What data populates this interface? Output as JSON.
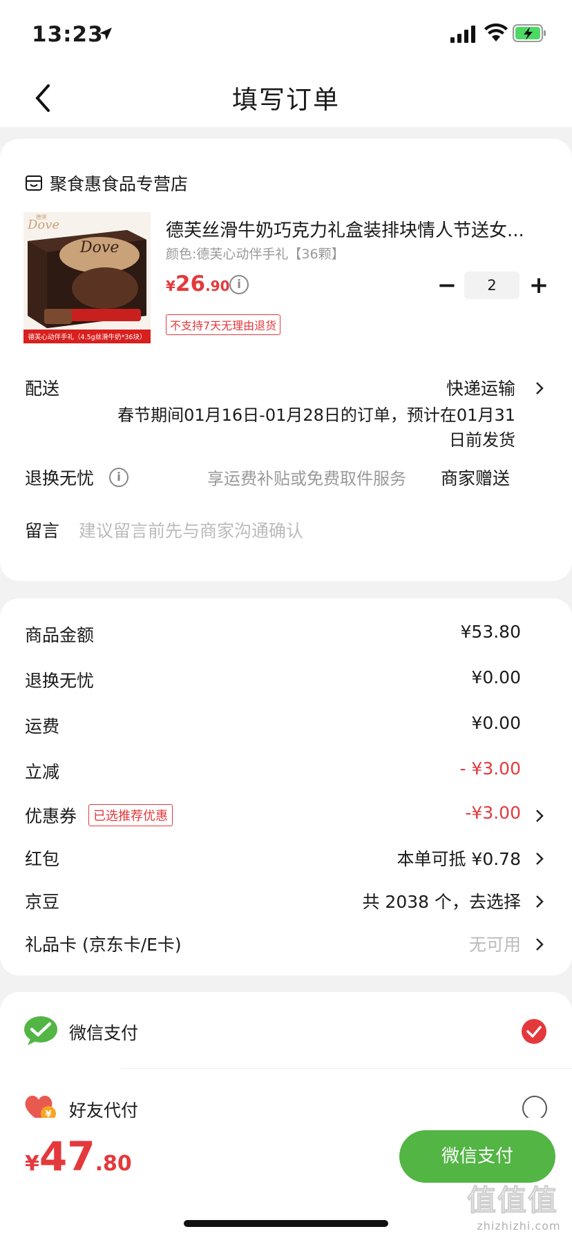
{
  "status_bar": {
    "time": "13:23"
  },
  "nav": {
    "title": "填写订单"
  },
  "store": {
    "name": "聚食惠食品专营店"
  },
  "product": {
    "title": "德芙丝滑牛奶巧克力礼盒装排块情人节送女...",
    "spec": "颜色:德芙心动伴手礼【36颗】",
    "price_currency": "¥",
    "price_int": "26",
    "price_dec": ".90",
    "quantity": "2",
    "badge": "不支持7天无理由退货",
    "image_brand": "Dove",
    "image_brand2": "Dove",
    "image_brand_small": "德芙",
    "image_caption": "德芙心动伴手礼（4.5g丝滑牛奶*36块）"
  },
  "delivery": {
    "label": "配送",
    "method": "快递运输",
    "note_line1": "春节期间01月16日-01月28日的订单，预计在01月31",
    "note_line2": "日前发货"
  },
  "return": {
    "label": "退换无忧",
    "desc": "享运费补贴或免费取件服务",
    "value": "商家赠送"
  },
  "message": {
    "label": "留言",
    "placeholder": "建议留言前先与商家沟通确认"
  },
  "summary": {
    "goods_label": "商品金额",
    "goods_value": "¥53.80",
    "return_label": "退换无忧",
    "return_value": "¥0.00",
    "freight_label": "运费",
    "freight_value": "¥0.00",
    "discount_label": "立减",
    "discount_value": "- ¥3.00",
    "coupon_label": "优惠券",
    "coupon_tag": "已选推荐优惠",
    "coupon_value": "-¥3.00",
    "redpacket_label": "红包",
    "redpacket_value": "本单可抵 ¥0.78",
    "jingdou_label": "京豆",
    "jingdou_value": "共 2038 个，去选择",
    "giftcard_label": "礼品卡 (京东卡/E卡)",
    "giftcard_value": "无可用"
  },
  "payment": {
    "wechat_label": "微信支付",
    "friend_label": "好友代付",
    "friend_icon_symbol": "¥"
  },
  "footer": {
    "total_currency": "¥",
    "total_int": "47",
    "total_dec": ".80",
    "pay_button": "微信支付"
  },
  "watermark": {
    "main": "值值值",
    "sub": "zhizhizhi.com"
  },
  "colors": {
    "accent_red": "#e4393c",
    "wechat_green": "#52b544",
    "grey_text": "#999999"
  }
}
